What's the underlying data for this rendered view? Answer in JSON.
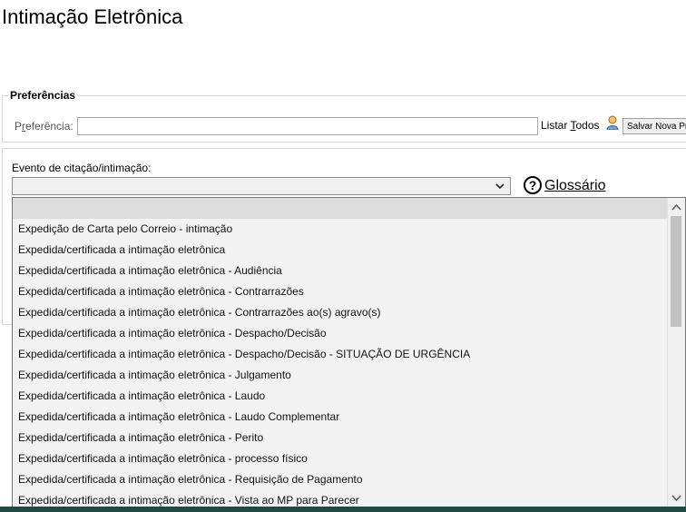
{
  "page": {
    "title": "Intimação Eletrônica"
  },
  "preferences": {
    "legend": "Preferências",
    "label_first": "P",
    "label_underlined": "r",
    "label_rest": "eferência:",
    "input_value": "",
    "listar_before": "Listar ",
    "listar_underlined": "T",
    "listar_after": "odos",
    "save_label": "Salvar Nova Preferência"
  },
  "evento": {
    "label": "Evento de citação/intimação:",
    "selected_value": "",
    "help_icon_glyph": "?",
    "glossario": "Glossário"
  },
  "dropdown": {
    "options": [
      "",
      "Expedição de Carta pelo Correio - intimação",
      "Expedida/certificada a intimação eletrônica",
      "Expedida/certificada a intimação eletrônica - Audiência",
      "Expedida/certificada a intimação eletrônica - Contrarrazões",
      "Expedida/certificada a intimação eletrônica - Contrarrazões ao(s) agravo(s)",
      "Expedida/certificada a intimação eletrônica - Despacho/Decisão",
      "Expedida/certificada a intimação eletrônica - Despacho/Decisão - SITUAÇÃO DE URGÊNCIA",
      "Expedida/certificada a intimação eletrônica - Julgamento",
      "Expedida/certificada a intimação eletrônica - Laudo",
      "Expedida/certificada a intimação eletrônica - Laudo Complementar",
      "Expedida/certificada a intimação eletrônica - Perito",
      "Expedida/certificada a intimação eletrônica - processo físico",
      "Expedida/certificada a intimação eletrônica - Requisição de Pagamento",
      "Expedida/certificada a intimação eletrônica - Vista ao MP para Parecer"
    ]
  },
  "colors": {
    "footer_bar": "#1f4a44",
    "selected_option": "#dcdcdc"
  }
}
